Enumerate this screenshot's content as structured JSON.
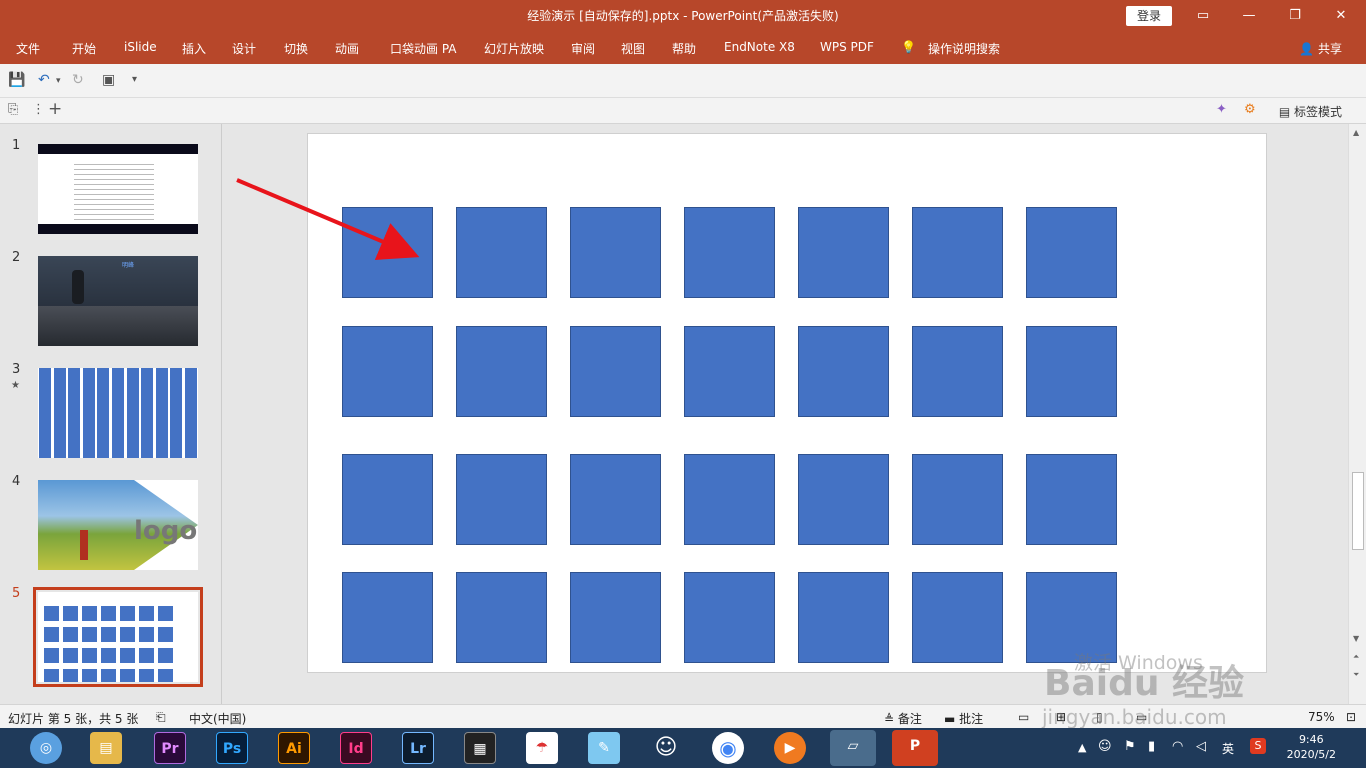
{
  "window": {
    "title": "经验演示 [自动保存的].pptx  -  PowerPoint(产品激活失败)",
    "login": "登录",
    "minimize": "—",
    "restore": "❐",
    "close": "✕"
  },
  "ribbon": {
    "tabs": [
      "文件",
      "开始",
      "iSlide",
      "插入",
      "设计",
      "切换",
      "动画",
      "口袋动画 PA",
      "幻灯片放映",
      "审阅",
      "视图",
      "帮助",
      "EndNote X8",
      "WPS PDF"
    ],
    "search": "操作说明搜索",
    "share": "共享"
  },
  "toolbar2": {
    "tag_mode": "标签模式"
  },
  "thumbnails": [
    {
      "num": "1",
      "star": false
    },
    {
      "num": "2",
      "star": false,
      "heading": "明峰"
    },
    {
      "num": "3",
      "star": true
    },
    {
      "num": "4",
      "star": false,
      "logo": "logo"
    },
    {
      "num": "5",
      "star": false,
      "selected": true
    }
  ],
  "slide": {
    "rows": 4,
    "cols": 7,
    "shape_color": "#4472c4"
  },
  "status": {
    "slide_info": "幻灯片 第 5 张，共 5 张",
    "language": "中文(中国)",
    "notes": "备注",
    "comments": "批注",
    "zoom": "75%"
  },
  "taskbar": {
    "apps": [
      "Pr",
      "Ps",
      "Ai",
      "Id",
      "Lr"
    ],
    "ime": "英",
    "time": "9:46",
    "date": "2020/5/2"
  },
  "watermark": {
    "activate": "激活 Windows",
    "brand": "Baidu 经验",
    "url": "jingyan.baidu.com"
  },
  "colors": {
    "accent": "#b7472a",
    "selected_border": "#c43e1c"
  }
}
